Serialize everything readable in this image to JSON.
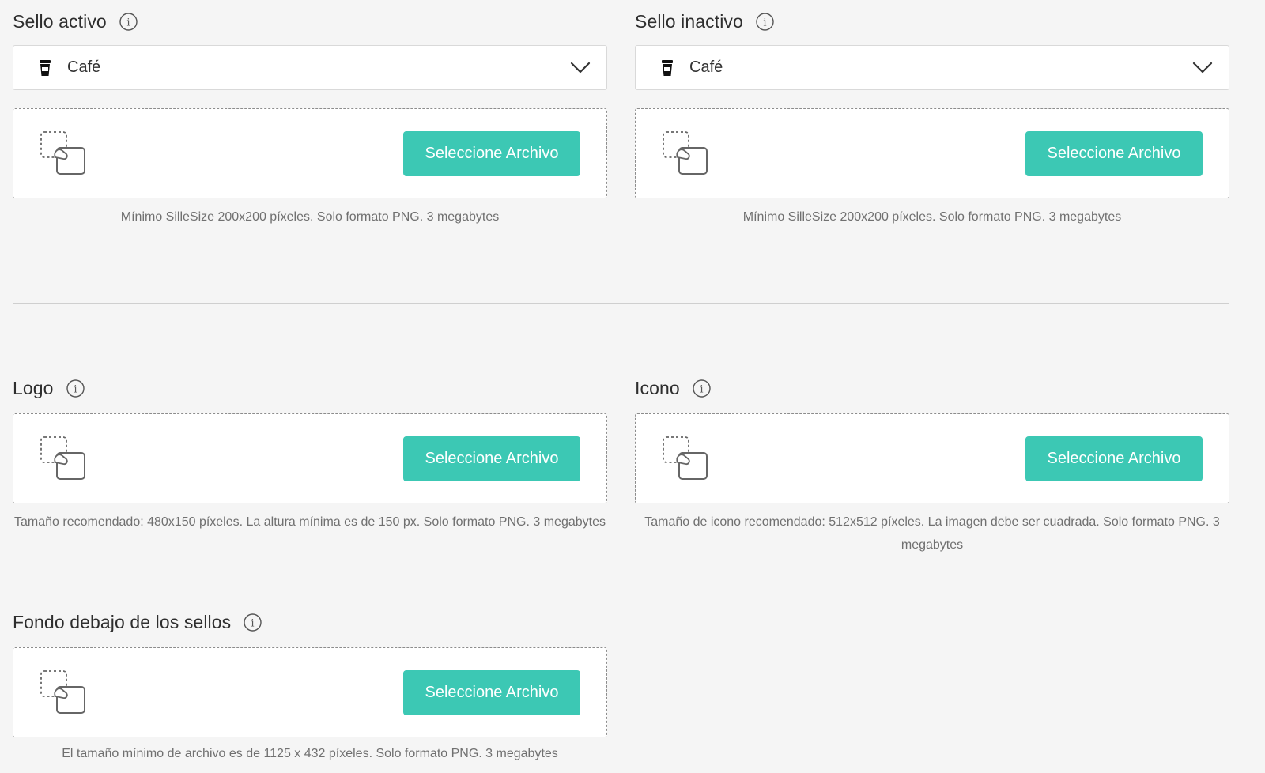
{
  "sello_activo": {
    "title": "Sello activo",
    "select_value": "Café",
    "button": "Seleccione Archivo",
    "hint": "Mínimo SilleSize 200x200 píxeles. Solo formato PNG. 3 megabytes"
  },
  "sello_inactivo": {
    "title": "Sello inactivo",
    "select_value": "Café",
    "button": "Seleccione Archivo",
    "hint": "Mínimo SilleSize 200x200 píxeles. Solo formato PNG. 3 megabytes"
  },
  "logo": {
    "title": "Logo",
    "button": "Seleccione Archivo",
    "hint": "Tamaño recomendado: 480x150 píxeles. La altura mínima es de 150 px. Solo formato PNG. 3 megabytes"
  },
  "icono": {
    "title": "Icono",
    "button": "Seleccione Archivo",
    "hint": "Tamaño de icono recomendado: 512x512 píxeles. La imagen debe ser cuadrada. Solo formato PNG. 3 megabytes"
  },
  "fondo": {
    "title": "Fondo debajo de los sellos",
    "button": "Seleccione Archivo",
    "hint": "El tamaño mínimo de archivo es de 1125 x 432 píxeles. Solo formato PNG. 3 megabytes"
  },
  "icons": {
    "info": "info-icon",
    "cup": "coffee-cup-icon",
    "chevron": "chevron-down-icon",
    "upload": "image-upload-icon"
  },
  "colors": {
    "accent": "#3cc8b4",
    "background": "#f5f5f5"
  }
}
